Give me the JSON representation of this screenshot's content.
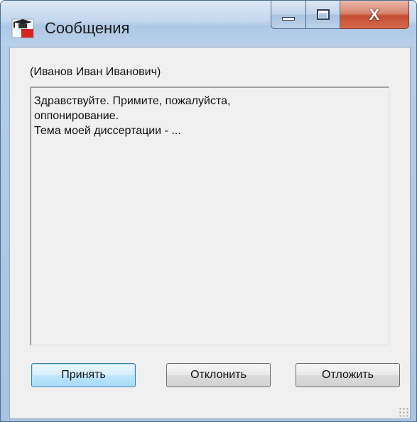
{
  "window": {
    "title": "Сообщения",
    "close_glyph": "X"
  },
  "message": {
    "sender": "(Иванов Иван Иванович)",
    "text": "Здравствуйте. Примите, пожалуйста,\nоппонирование.\nТема моей диссертации - ..."
  },
  "buttons": {
    "accept": "Принять",
    "decline": "Отклонить",
    "postpone": "Отложить"
  },
  "colors": {
    "frame": "#a9c3e0",
    "client": "#f0f0f0",
    "close_button": "#c34d2f",
    "focus_border": "#3c7fb1"
  },
  "icons": {
    "app": "graduate-cap-icon",
    "minimize": "minimize-icon",
    "maximize": "maximize-icon",
    "close": "close-icon",
    "resize": "resize-grip-icon"
  }
}
